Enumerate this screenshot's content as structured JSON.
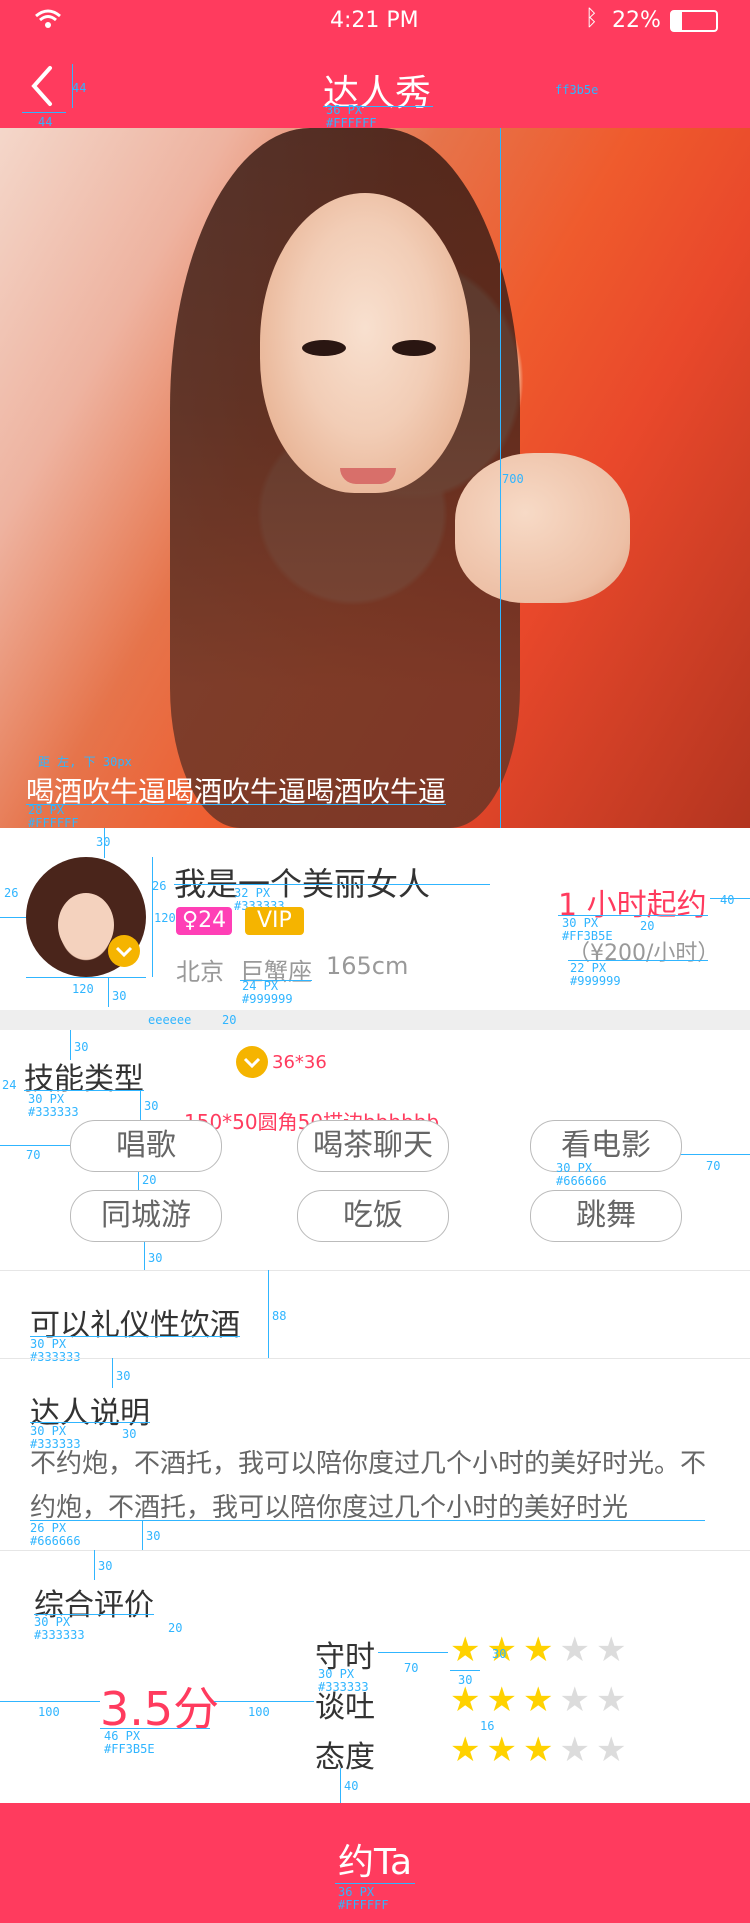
{
  "status_bar": {
    "time": "4:21 PM",
    "battery": "22%"
  },
  "header": {
    "title": "达人秀",
    "back_size_note": "44",
    "back_size_note2": "44",
    "color_note": "ff3b5e",
    "title_note_size": "36 PX",
    "title_note_color": "#FFFFFF"
  },
  "hero": {
    "caption": "喝酒吹牛逼喝酒吹牛逼喝酒吹牛逼",
    "height_note": "700",
    "caption_note_pos": "距 左, 下  30px",
    "caption_note_size": "28 PX",
    "caption_note_color": "#FFFFFF"
  },
  "profile": {
    "name": "我是一个美丽女人",
    "gender_age": "♀24",
    "vip": "VIP",
    "city": "北京",
    "zodiac": "巨蟹座",
    "height": "165cm",
    "price_line": "1 小时起约",
    "price_sub": "（¥200/小时）",
    "notes": {
      "top": "30",
      "left": "26",
      "gap": "26",
      "avatar": "120",
      "avatar_w": "120",
      "bottom": "30",
      "right": "40",
      "gap2": "20",
      "name_size": "32 PX",
      "name_color": "#333333",
      "meta_size": "24 PX",
      "meta_color": "#999999",
      "price_size": "30 PX",
      "price_color": "#FF3B5E",
      "sub_size": "22 PX",
      "sub_color": "#999999"
    }
  },
  "band_note": {
    "color": "eeeeee",
    "height": "20"
  },
  "skills": {
    "title": "技能类型",
    "icon_note": "36*36",
    "pill_note": "150*50圆角50描边bbbbbb",
    "items": [
      "唱歌",
      "喝茶聊天",
      "看电影",
      "同城游",
      "吃饭",
      "跳舞"
    ],
    "notes": {
      "top": "30",
      "left": "24",
      "title_size": "30 PX",
      "title_color": "#333333",
      "gap": "30",
      "left_pad": "70",
      "right_pad": "70",
      "row_gap": "20",
      "bottom": "30",
      "pill_size": "30 PX",
      "pill_color": "#666666"
    }
  },
  "drink": {
    "text": "可以礼仪性饮酒",
    "height_note": "88",
    "size": "30 PX",
    "color": "#333333"
  },
  "intro": {
    "title": "达人说明",
    "text": "不约炮，不酒托，我可以陪你度过几个小时的美好时光。不约炮，不酒托，我可以陪你度过几个小时的美好时光",
    "notes": {
      "top": "30",
      "title_size": "30 PX",
      "title_color": "#333333",
      "gap": "30",
      "text_size": "26 PX",
      "text_color": "#666666",
      "bottom": "30"
    }
  },
  "rating": {
    "title": "综合评价",
    "score": "3.5分",
    "items": [
      {
        "label": "守时",
        "stars": 3
      },
      {
        "label": "谈吐",
        "stars": 3
      },
      {
        "label": "态度",
        "stars": 3
      }
    ],
    "max_stars": 5,
    "notes": {
      "top": "30",
      "title_size": "30 PX",
      "title_color": "#333333",
      "gap": "20",
      "left": "100",
      "right": "100",
      "score_size": "46 PX",
      "score_color": "#FF3B5E",
      "label_gap": "70",
      "star_size": "30",
      "star_gap": "30",
      "star_row_gap": "16",
      "label_size": "30 PX",
      "label_color": "#333333",
      "bottom": "40"
    }
  },
  "cta": {
    "label": "约Ta",
    "size": "36 PX",
    "color": "#FFFFFF"
  }
}
